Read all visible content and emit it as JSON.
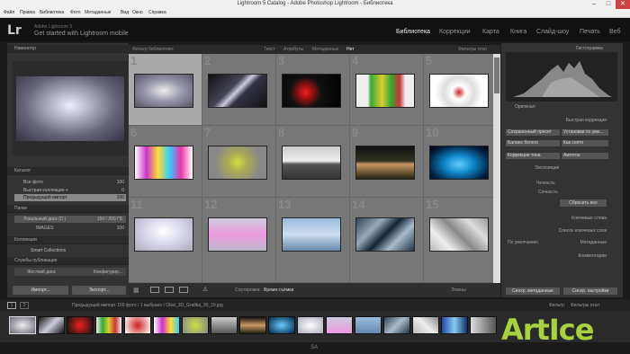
{
  "window": {
    "title": "Lightroom 5 Catalog - Adobe Photoshop Lightroom - Библиотека"
  },
  "menu": [
    "Файл",
    "Правка",
    "Библиотека",
    "Фото",
    "Метаданные",
    "Вид",
    "Окно",
    "Справка"
  ],
  "identity": {
    "logo": "Lr",
    "line1": "Adobe Lightroom 5",
    "line2": "Get started with Lightroom mobile"
  },
  "modules": [
    "Библиотека",
    "Коррекции",
    "Карта",
    "Книга",
    "Слайд-шоу",
    "Печать",
    "Веб"
  ],
  "left": {
    "navigator": "Навигатор",
    "catalog": "Каталог",
    "catalog_items": [
      {
        "label": "Все фото",
        "count": "100"
      },
      {
        "label": "Быстрая коллекция +",
        "count": "0"
      },
      {
        "label": "Предыдущий импорт",
        "count": "100"
      }
    ],
    "folders": "Папки",
    "drive": "Локальный диск (C:)",
    "drive_info": "150 / 200 ГБ",
    "folder": "IMAGES",
    "folder_count": "100",
    "collections": "Коллекции",
    "smart": "Smart Collections",
    "publish": "Службы публикации",
    "harddrive": "Жесткий диск",
    "harddrive_action": "Конфигурир...",
    "import": "Импорт...",
    "export": "Экспорт..."
  },
  "filter": {
    "title": "Фильтр библиотеки:",
    "text": "Текст",
    "attr": "Атрибуты",
    "meta": "Метаданные",
    "none": "Нет",
    "off": "Фильтры откл"
  },
  "grid": {
    "nums": [
      "1",
      "2",
      "3",
      "4",
      "5",
      "6",
      "7",
      "8",
      "9",
      "10",
      "11",
      "12",
      "13",
      "14",
      "15"
    ]
  },
  "toolbar": {
    "sort": "Сортировка:",
    "sort_val": "Время съёмки",
    "thumbs": "Эскизы"
  },
  "right": {
    "histogram": "Гистограмма",
    "original": "Оригинал",
    "quick": "Быстрая коррекция",
    "preset": "Сохраненный пресет",
    "preset_val": "Установки по умо...",
    "wb": "Баланс белого",
    "wb_val": "Как снято",
    "tone": "Коррекция тона",
    "auto": "Автотон",
    "exposure": "Экспозиция",
    "clarity": "Четкость",
    "vibrance": "Сочность",
    "reset": "Сбросить все",
    "keywording": "Ключевые слова",
    "keyword_list": "Список ключевых слов",
    "default": "По умолчанию",
    "metadata": "Метаданные",
    "comments": "Комментарии",
    "sync_meta": "Синхр. метаданные",
    "sync_settings": "Синхр. настройки"
  },
  "strip": {
    "pages": [
      "1",
      "2"
    ],
    "info": "Предыдущий импорт  100 фото / 1 выбрано / Obst_3D_Grafika_30_19.jpg",
    "filter": "Фильтр:",
    "filter_val": "Фильтры откл"
  },
  "watermark": "ArtIce",
  "bottom": "SA"
}
